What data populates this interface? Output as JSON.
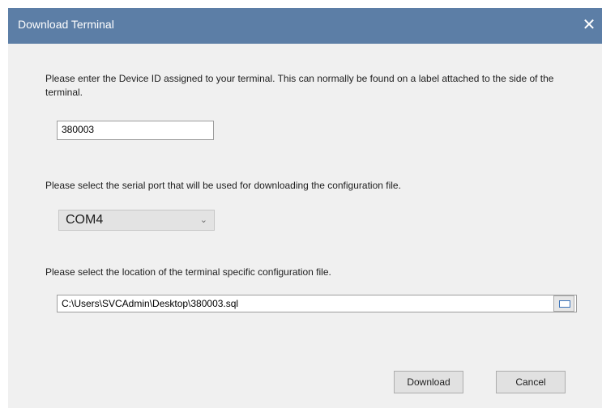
{
  "dialog": {
    "title": "Download Terminal",
    "close_glyph": "✕"
  },
  "device_id": {
    "prompt": "Please enter the Device ID assigned to your terminal.  This can normally be found on a label attached to the side of the terminal.",
    "value": "380003"
  },
  "serial_port": {
    "prompt": "Please select the serial port that will be used for downloading the configuration file.",
    "selected": "COM4",
    "dropdown_glyph": "⌄"
  },
  "config_file": {
    "prompt": "Please select the location of the terminal specific configuration file.",
    "path": "C:\\Users\\SVCAdmin\\Desktop\\380003.sql",
    "browse_icon": "browse-folder-icon"
  },
  "buttons": {
    "download": "Download",
    "cancel": "Cancel"
  }
}
